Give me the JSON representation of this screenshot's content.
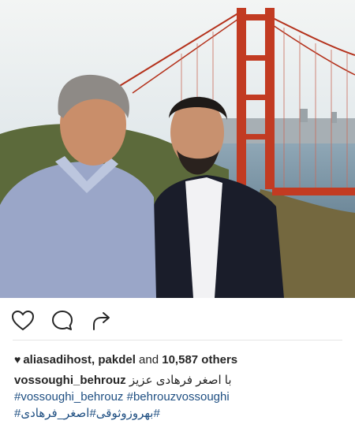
{
  "post": {
    "image_alt": "Two men standing in front of the Golden Gate Bridge"
  },
  "actions": {
    "like_icon": "heart-outline-icon",
    "comment_icon": "speech-bubble-icon",
    "share_icon": "share-arrow-icon"
  },
  "likes": {
    "heart_icon": "♥",
    "users": "aliasadihost, pakdel",
    "and_text": "and",
    "others": "10,587 others"
  },
  "caption": {
    "username": "vossoughi_behrouz",
    "text": "با اصغر فرهادی عزیز",
    "hashtags_line1": [
      "#vossoughi_behrouz",
      "#behrouzvossoughi"
    ],
    "hashtags_line2": "#بهروزوثوقی#اصغر_فرهادی#"
  },
  "colors": {
    "hashtag": "#1f4f82",
    "bridge": "#c23b22",
    "sky": "#dfe6ea"
  }
}
